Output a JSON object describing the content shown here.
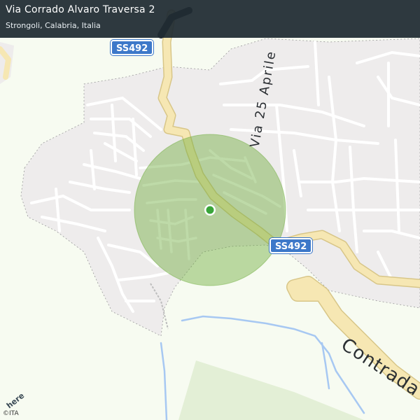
{
  "header": {
    "title": "Via Corrado Alvaro Traversa 2",
    "subtitle": "Strongoli, Calabria, Italia"
  },
  "road_shields": [
    {
      "label": "SS492"
    },
    {
      "label": "SS492"
    }
  ],
  "street_labels": {
    "via_25_aprile": "Via 25 Aprile",
    "contrada": "Contrada"
  },
  "branding": {
    "logo_text": "here",
    "copyright": "©ITA"
  },
  "colors": {
    "land": "#f7fbf1",
    "urban": "#eeecec",
    "road_white": "#ffffff",
    "road_major": "#f6e7b3",
    "water": "#a7c8f2",
    "radius_fill": "#6fae3d",
    "location_dot": "#3aa53a"
  }
}
